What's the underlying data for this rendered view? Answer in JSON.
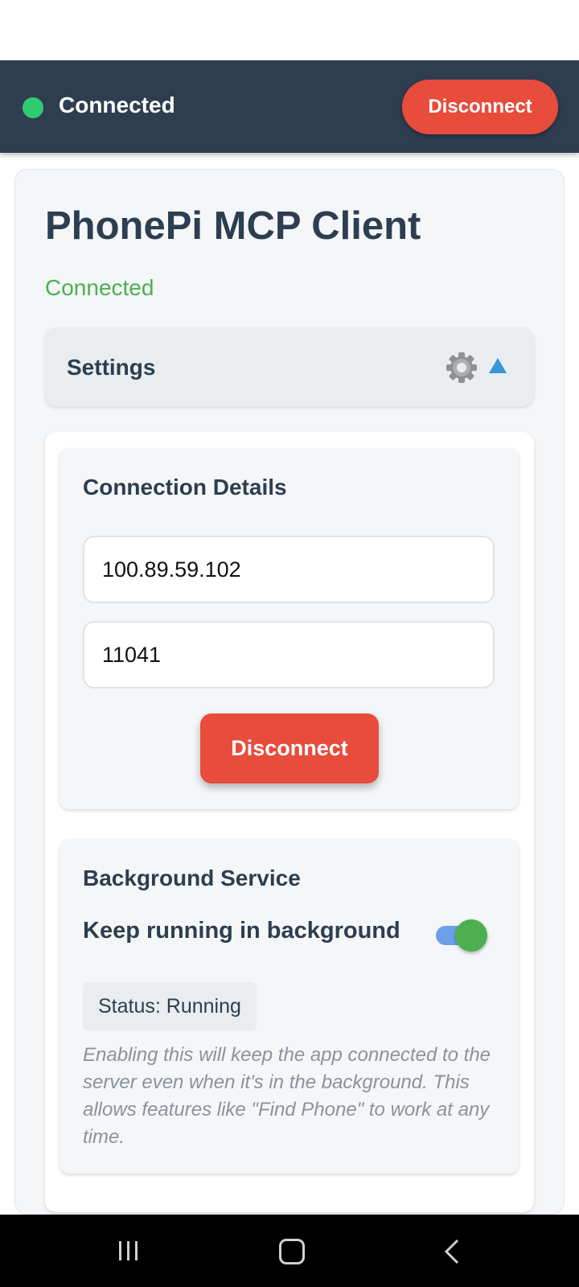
{
  "header": {
    "status_text": "Connected",
    "disconnect_label": "Disconnect",
    "status_color": "#2ecc71",
    "background_color": "#2e3e50"
  },
  "main": {
    "title": "PhonePi MCP Client",
    "status_text": "Connected",
    "status_color": "#4caf50"
  },
  "settings": {
    "label": "Settings",
    "expanded": true,
    "icons": [
      "gear-icon",
      "triangle-up-icon"
    ]
  },
  "connection": {
    "title": "Connection Details",
    "ip_value": "100.89.59.102",
    "port_value": "11041",
    "disconnect_label": "Disconnect",
    "button_color": "#e74c3c"
  },
  "background_service": {
    "title": "Background Service",
    "toggle_label": "Keep running in background",
    "toggle_on": true,
    "status_text": "Status: Running",
    "help_text": "Enabling this will keep the app connected to the server even when it's in the background. This allows features like \"Find Phone\" to work at any time."
  },
  "nav_bar": {
    "icons": [
      "recents-icon",
      "home-icon",
      "back-icon"
    ]
  }
}
